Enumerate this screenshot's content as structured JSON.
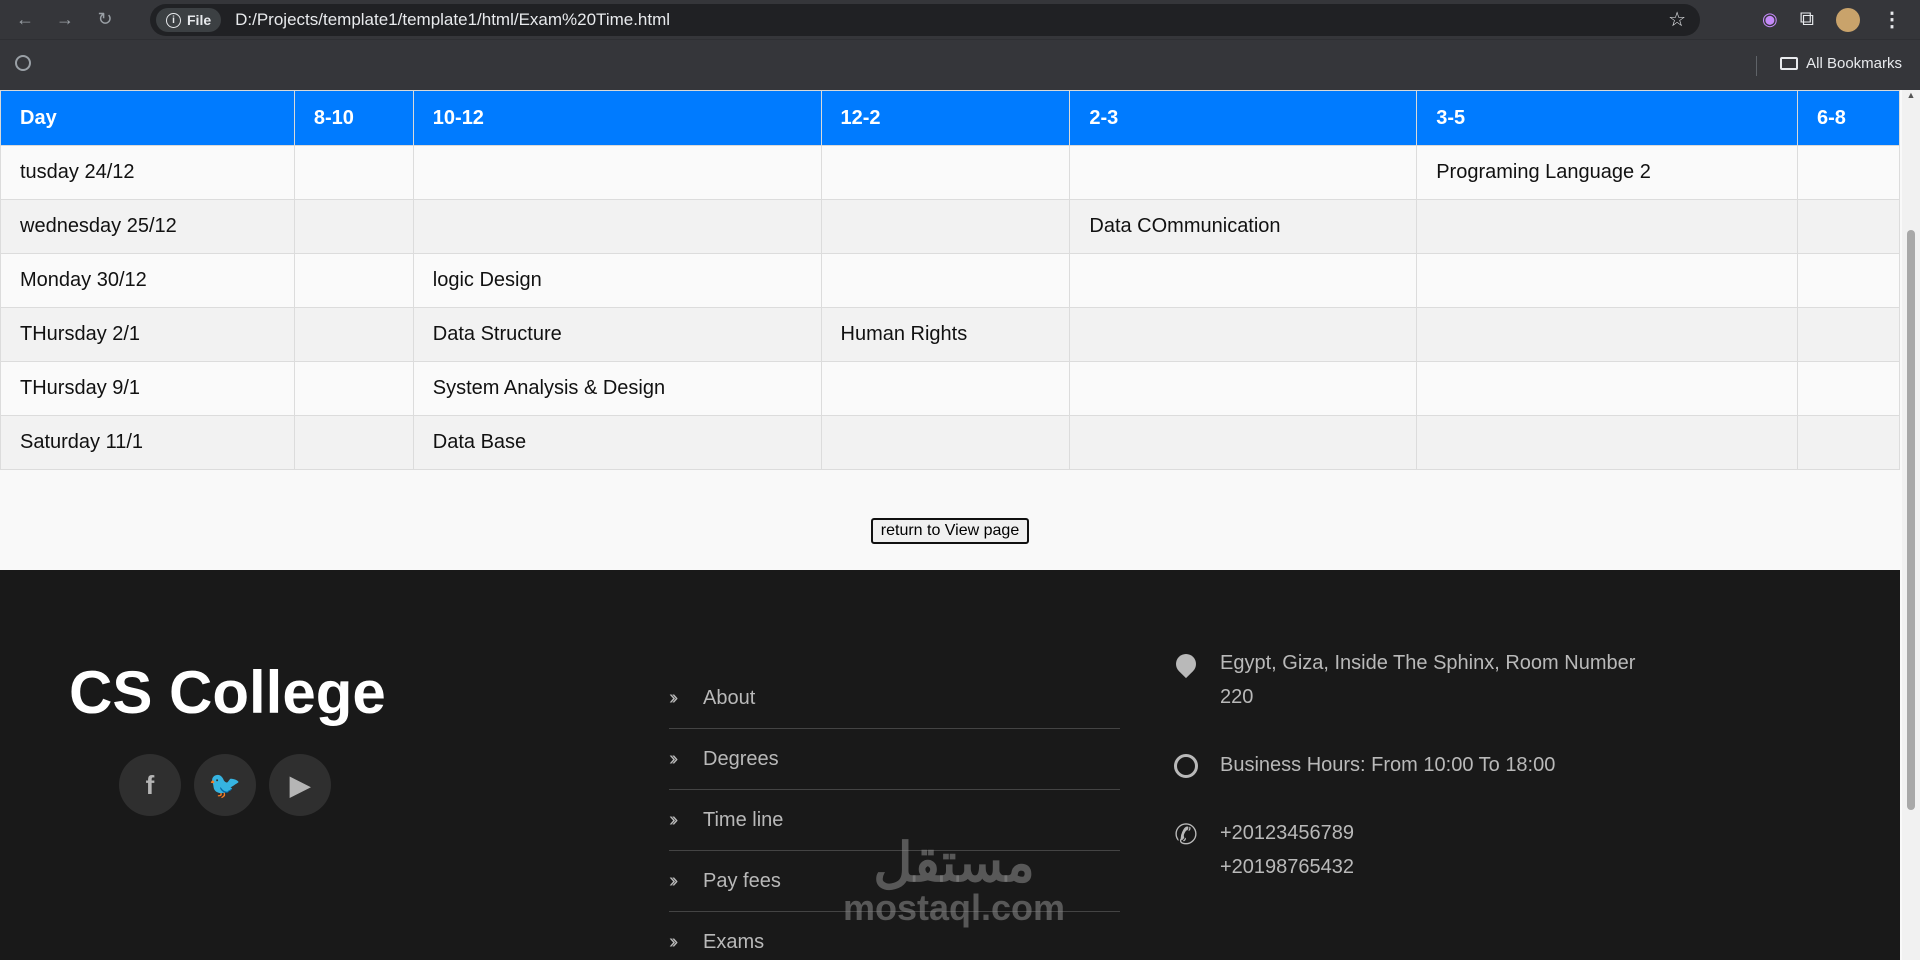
{
  "browser": {
    "file_chip": "File",
    "url": "D:/Projects/template1/template1/html/Exam%20Time.html",
    "bookmarks_label": "All Bookmarks"
  },
  "table": {
    "headers": [
      "Day",
      "8-10",
      "10-12",
      "12-2",
      "2-3",
      "3-5",
      "6-8"
    ],
    "rows": [
      [
        "tusday 24/12",
        "",
        "",
        "",
        "",
        "Programing Language 2",
        ""
      ],
      [
        "wednesday 25/12",
        "",
        "",
        "",
        "Data COmmunication",
        "",
        ""
      ],
      [
        "Monday 30/12",
        "",
        "logic Design",
        "",
        "",
        "",
        ""
      ],
      [
        "THursday 2/1",
        "",
        "Data Structure",
        "Human Rights",
        "",
        "",
        ""
      ],
      [
        "THursday 9/1",
        "",
        "System Analysis & Design",
        "",
        "",
        "",
        ""
      ],
      [
        "Saturday 11/1",
        "",
        "Data Base",
        "",
        "",
        "",
        ""
      ]
    ]
  },
  "return_button": "return to View page",
  "footer": {
    "brand": "CS College",
    "socials": [
      {
        "icon": "facebook-icon",
        "glyph": "f"
      },
      {
        "icon": "twitter-icon",
        "glyph": "🐦"
      },
      {
        "icon": "youtube-icon",
        "glyph": "▶"
      }
    ],
    "links": [
      "About",
      "Degrees",
      "Time line",
      "Pay fees",
      "Exams"
    ],
    "contact": {
      "address": "Egypt, Giza, Inside The Sphinx, Room Number 220",
      "hours": "Business Hours: From 10:00 To 18:00",
      "phone1": "+20123456789",
      "phone2": "+20198765432"
    }
  },
  "watermark": {
    "arabic": "مستقل",
    "latin": "mostaql.com"
  }
}
